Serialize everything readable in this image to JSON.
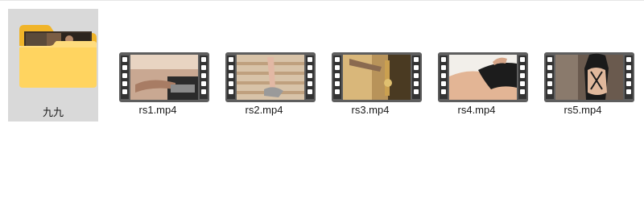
{
  "folder": {
    "name": "九九"
  },
  "files": [
    {
      "name": "rs1.mp4"
    },
    {
      "name": "rs2.mp4"
    },
    {
      "name": "rs3.mp4"
    },
    {
      "name": "rs4.mp4"
    },
    {
      "name": "rs5.mp4"
    }
  ]
}
